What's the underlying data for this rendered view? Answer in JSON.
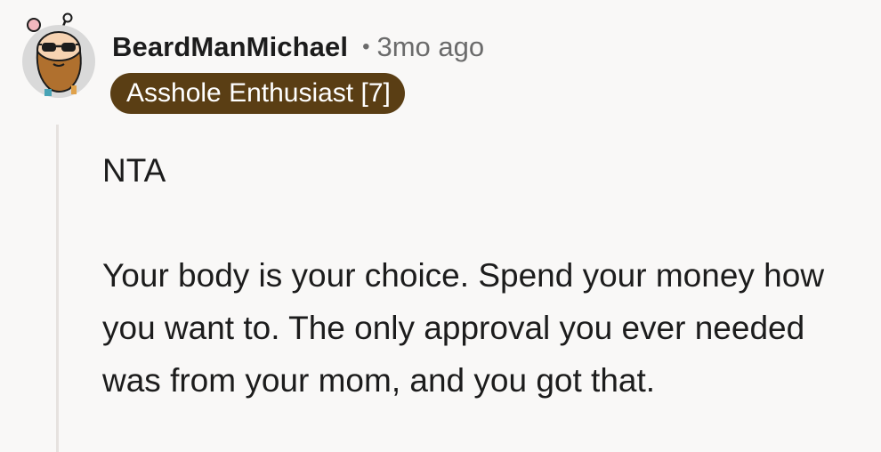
{
  "comment": {
    "author": "BeardManMichael",
    "separator": "•",
    "timestamp": "3mo ago",
    "flair": "Asshole Enthusiast [7]",
    "avatar_icon": "bearded-sunglasses-avatar-icon",
    "paragraphs": [
      "NTA",
      "Your body is your choice. Spend your money how you want to. The only approval you ever needed was from your mom, and you got that."
    ]
  },
  "colors": {
    "background": "#f9f8f7",
    "flair_bg": "#5a3e14",
    "flair_text": "#ffffff",
    "meta_text": "#6b6b6b",
    "thread_line": "#e6e2df"
  }
}
